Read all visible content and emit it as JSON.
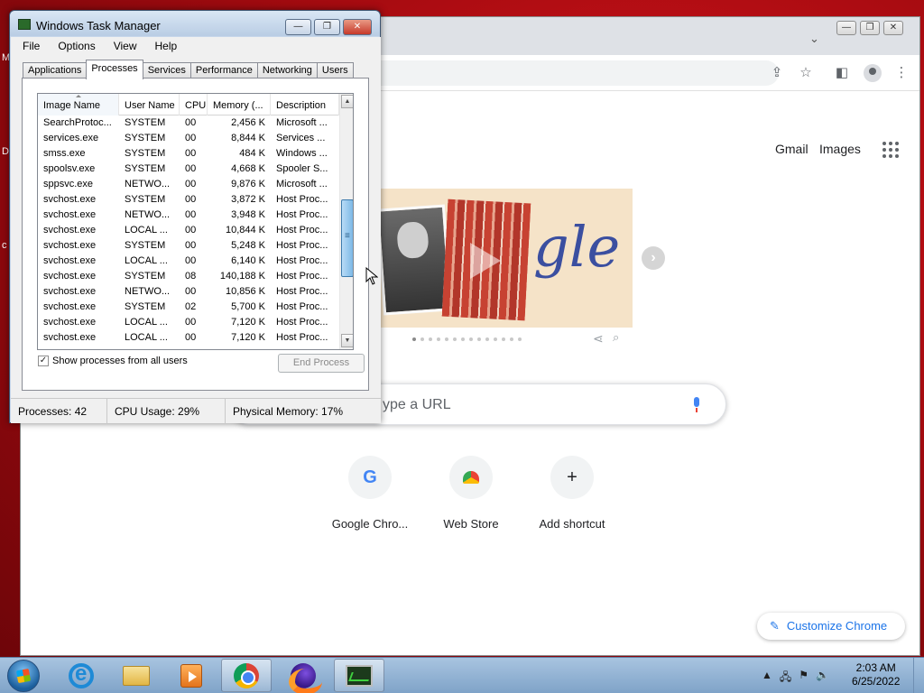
{
  "desktop": {
    "edge_letters": [
      "M",
      "D",
      "c"
    ]
  },
  "chrome": {
    "window_controls": {
      "minimize": "—",
      "maximize": "❐",
      "close": "✕"
    },
    "tab_search": "⌄",
    "gmail_label": "Gmail",
    "images_label": "Images",
    "search_placeholder": "ype a URL",
    "shortcuts": [
      {
        "label": "Google Chro...",
        "icon": "google-g-icon"
      },
      {
        "label": "Web Store",
        "icon": "web-store-icon"
      },
      {
        "label": "Add shortcut",
        "icon": "plus-icon"
      }
    ],
    "customize_label": "Customize Chrome",
    "doodle_text": "gle"
  },
  "task_manager": {
    "title": "Windows Task Manager",
    "menu": [
      "File",
      "Options",
      "View",
      "Help"
    ],
    "tabs": [
      "Applications",
      "Processes",
      "Services",
      "Performance",
      "Networking",
      "Users"
    ],
    "active_tab": "Processes",
    "columns": [
      "Image Name",
      "User Name",
      "CPU",
      "Memory (...",
      "Description"
    ],
    "rows": [
      [
        "SearchProtoc...",
        "SYSTEM",
        "00",
        "2,456 K",
        "Microsoft ..."
      ],
      [
        "services.exe",
        "SYSTEM",
        "00",
        "8,844 K",
        "Services ..."
      ],
      [
        "smss.exe",
        "SYSTEM",
        "00",
        "484 K",
        "Windows ..."
      ],
      [
        "spoolsv.exe",
        "SYSTEM",
        "00",
        "4,668 K",
        "Spooler S..."
      ],
      [
        "sppsvc.exe",
        "NETWO...",
        "00",
        "9,876 K",
        "Microsoft ..."
      ],
      [
        "svchost.exe",
        "SYSTEM",
        "00",
        "3,872 K",
        "Host Proc..."
      ],
      [
        "svchost.exe",
        "NETWO...",
        "00",
        "3,948 K",
        "Host Proc..."
      ],
      [
        "svchost.exe",
        "LOCAL ...",
        "00",
        "10,844 K",
        "Host Proc..."
      ],
      [
        "svchost.exe",
        "SYSTEM",
        "00",
        "5,248 K",
        "Host Proc..."
      ],
      [
        "svchost.exe",
        "LOCAL ...",
        "00",
        "6,140 K",
        "Host Proc..."
      ],
      [
        "svchost.exe",
        "SYSTEM",
        "08",
        "140,188 K",
        "Host Proc..."
      ],
      [
        "svchost.exe",
        "NETWO...",
        "00",
        "10,856 K",
        "Host Proc..."
      ],
      [
        "svchost.exe",
        "SYSTEM",
        "02",
        "5,700 K",
        "Host Proc..."
      ],
      [
        "svchost.exe",
        "LOCAL ...",
        "00",
        "7,120 K",
        "Host Proc..."
      ],
      [
        "svchost.exe",
        "LOCAL ...",
        "00",
        "7,120 K",
        "Host Proc..."
      ]
    ],
    "show_all_label": "Show processes from all users",
    "show_all_checked": true,
    "end_process_label": "End Process",
    "status": {
      "processes": "Processes: 42",
      "cpu": "CPU Usage: 29%",
      "memory": "Physical Memory: 17%"
    }
  },
  "taskbar": {
    "apps": [
      "internet-explorer",
      "file-explorer",
      "media-player",
      "google-chrome",
      "firefox",
      "task-manager"
    ],
    "active_apps": [
      "google-chrome",
      "task-manager"
    ],
    "clock_time": "2:03 AM",
    "clock_date": "6/25/2022"
  }
}
